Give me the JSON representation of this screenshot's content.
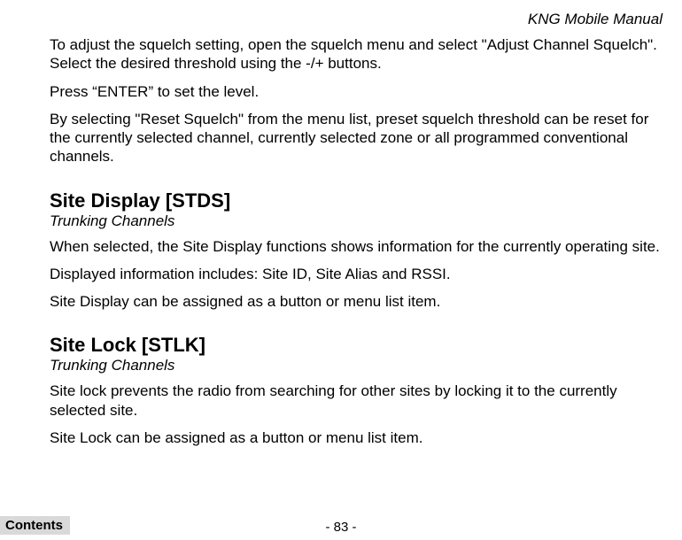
{
  "header": {
    "title": "KNG Mobile Manual"
  },
  "body": {
    "p1": "To adjust the squelch setting, open the squelch menu and select \"Adjust Channel Squelch\". Select the desired threshold using the -/+ buttons.",
    "p2": "Press “ENTER” to set the level.",
    "p3": "By selecting \"Reset Squelch\" from the menu list, preset squelch threshold can be reset for the currently selected channel, currently selected zone or all programmed conventional channels."
  },
  "sections": {
    "site_display": {
      "heading": "Site Display [STDS]",
      "subheading": "Trunking Channels",
      "p1": "When selected, the Site Display functions shows information for the currently operating site.",
      "p2": "Displayed information includes: Site ID, Site Alias and RSSI.",
      "p3": "Site Display can be assigned as a button or menu list item."
    },
    "site_lock": {
      "heading": "Site Lock [STLK]",
      "subheading": "Trunking Channels",
      "p1": "Site lock prevents the radio from searching for other sites by locking it to the currently selected site.",
      "p2": "Site Lock can be assigned as a button or menu list item."
    }
  },
  "footer": {
    "page_number": "- 83 -",
    "contents_label": "Contents"
  }
}
